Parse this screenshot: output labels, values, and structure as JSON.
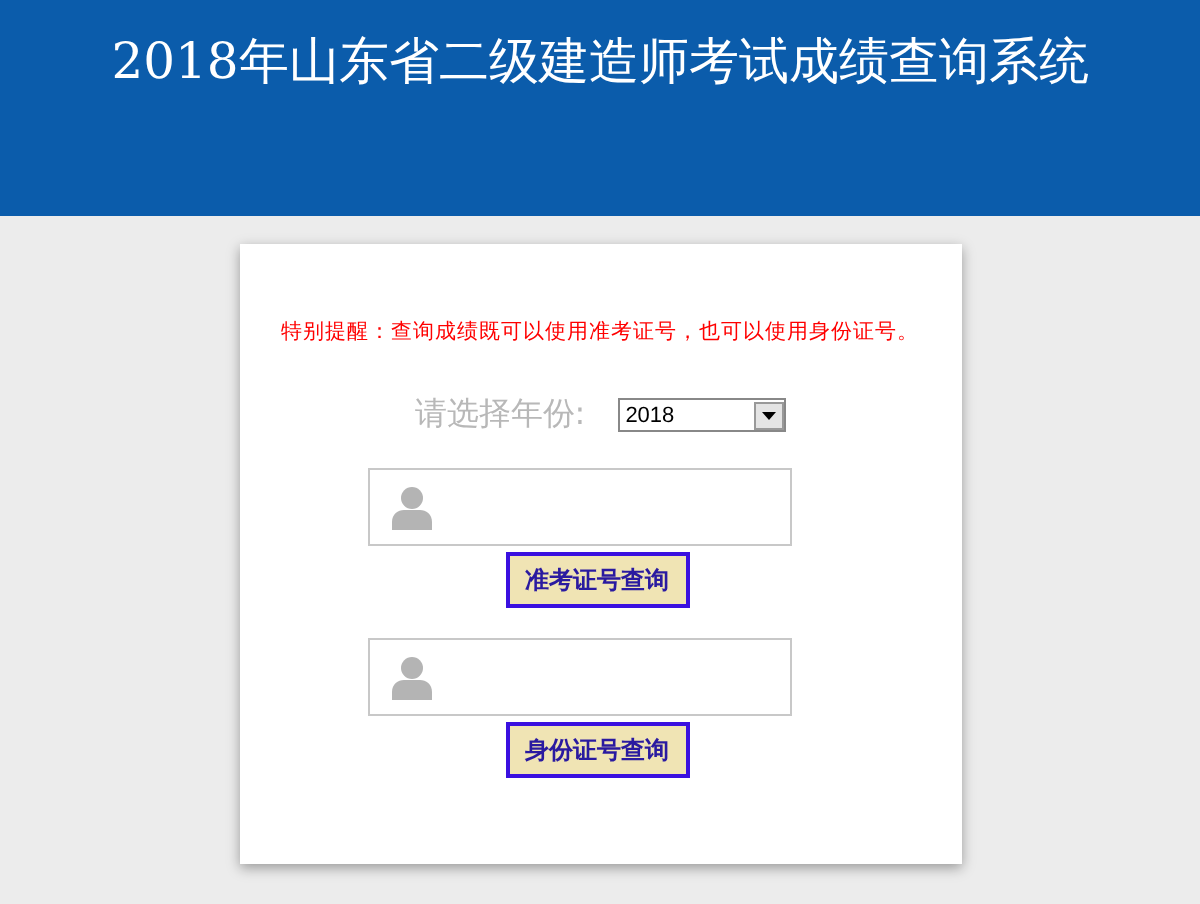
{
  "header": {
    "title": "2018年山东省二级建造师考试成绩查询系统"
  },
  "notice": "特别提醒：查询成绩既可以使用准考证号，也可以使用身份证号。",
  "year": {
    "label": "请选择年份:",
    "value": "2018"
  },
  "queries": [
    {
      "button": "准考证号查询"
    },
    {
      "button": "身份证号查询"
    }
  ]
}
